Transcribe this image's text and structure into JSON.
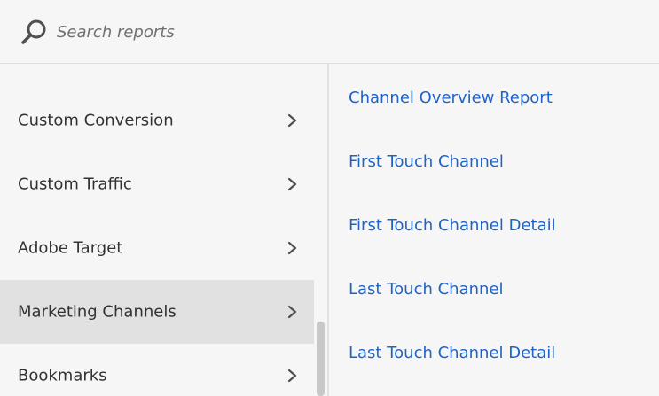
{
  "search": {
    "placeholder": "Search reports"
  },
  "menu": {
    "items": [
      {
        "label": "Custom Conversion",
        "selected": false
      },
      {
        "label": "Custom Traffic",
        "selected": false
      },
      {
        "label": "Adobe Target",
        "selected": false
      },
      {
        "label": "Marketing Channels",
        "selected": true
      },
      {
        "label": "Bookmarks",
        "selected": false
      }
    ]
  },
  "reports": {
    "links": [
      "Channel Overview Report",
      "First Touch Channel",
      "First Touch Channel Detail",
      "Last Touch Channel",
      "Last Touch Channel Detail"
    ]
  },
  "colors": {
    "link": "#1e64c8",
    "selected_bg": "#e1e1e1",
    "background": "#f6f6f6"
  }
}
